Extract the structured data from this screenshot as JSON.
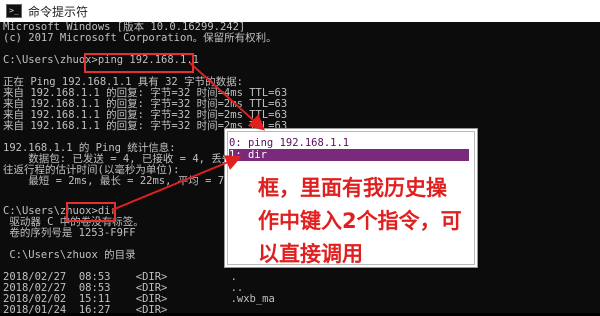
{
  "window": {
    "title": "命令提示符"
  },
  "console_lines": [
    "Microsoft Windows [版本 10.0.16299.242]",
    "(c) 2017 Microsoft Corporation。保留所有权利。",
    "",
    "C:\\Users\\zhuox>ping 192.168.1.1",
    "",
    "正在 Ping 192.168.1.1 具有 32 字节的数据:",
    "来自 192.168.1.1 的回复: 字节=32 时间=4ms TTL=63",
    "来自 192.168.1.1 的回复: 字节=32 时间=2ms TTL=63",
    "来自 192.168.1.1 的回复: 字节=32 时间=2ms TTL=63",
    "来自 192.168.1.1 的回复: 字节=32 时间=2ms TTL=63",
    "",
    "192.168.1.1 的 Ping 统计信息:",
    "    数据包: 已发送 = 4, 已接收 = 4, 丢失",
    "往返行程的估计时间(以毫秒为单位):",
    "    最短 = 2ms, 最长 = 22ms, 平均 = 7ms",
    "",
    "C:\\Users\\zhuox>dir",
    " 驱动器 C 中的卷没有标签。",
    " 卷的序列号是 1253-F9FF",
    "",
    " C:\\Users\\zhuox 的目录",
    "",
    "2018/02/27  08:53    <DIR>          .",
    "2018/02/27  08:53    <DIR>          ..",
    "2018/02/02  15:11    <DIR>          .wxb_ma",
    "2018/01/24  16:27    <DIR>"
  ],
  "history_popup": {
    "items": [
      {
        "label": "0: ping 192.168.1.1",
        "selected": false
      },
      {
        "label": "1: dir",
        "selected": true
      }
    ]
  },
  "annotation": {
    "text": "框，里面有我历史操\n作中键入2个指令，可\n以直接调用",
    "color": "#e02020"
  }
}
